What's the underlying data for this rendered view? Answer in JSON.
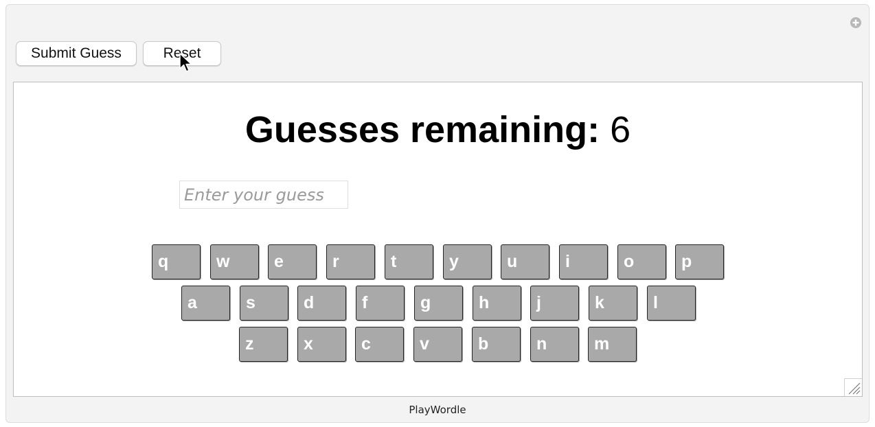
{
  "toolbar": {
    "submit_label": "Submit Guess",
    "reset_label": "Reset"
  },
  "game": {
    "title_label": "Guesses remaining:",
    "guesses_remaining": "6",
    "input_placeholder": "Enter your guess",
    "input_value": ""
  },
  "keyboard": {
    "rows": [
      [
        "q",
        "w",
        "e",
        "r",
        "t",
        "y",
        "u",
        "i",
        "o",
        "p"
      ],
      [
        "a",
        "s",
        "d",
        "f",
        "g",
        "h",
        "j",
        "k",
        "l"
      ],
      [
        "z",
        "x",
        "c",
        "v",
        "b",
        "n",
        "m"
      ]
    ],
    "key_color": "#a9a9a9",
    "key_text_color": "#ffffff"
  },
  "footer": {
    "label": "PlayWordle"
  },
  "icons": {
    "panel_corner": "plus-circle-icon",
    "grip": "resize-grip-icon",
    "pointer": "mouse-cursor-icon"
  }
}
